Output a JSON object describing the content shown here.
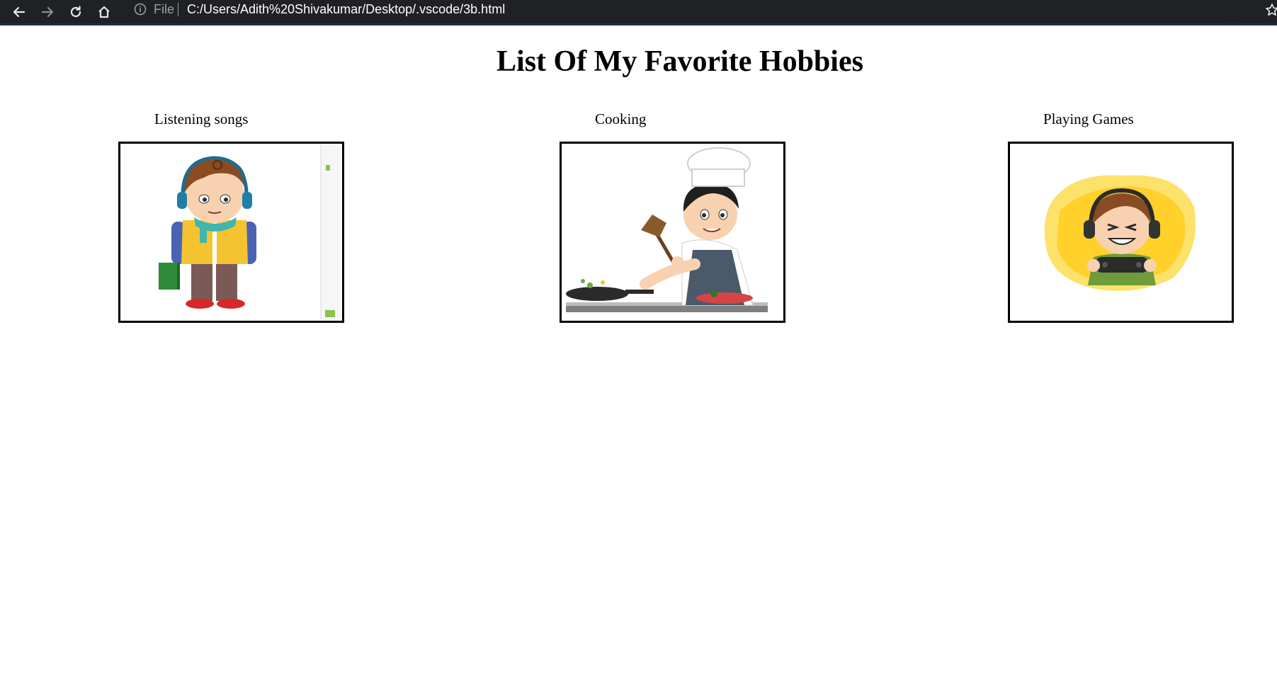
{
  "browser": {
    "url_scheme": "File",
    "url": "C:/Users/Adith%20Shivakumar/Desktop/.vscode/3b.html",
    "icons": {
      "back": "back-arrow-icon",
      "forward": "forward-arrow-icon",
      "reload": "reload-icon",
      "home": "home-icon",
      "info": "info-icon",
      "bookmark": "star-icon"
    },
    "colors": {
      "toolbar": "#202124",
      "url_text": "#ffffff",
      "muted": "#9aa0a6"
    }
  },
  "page": {
    "title": "List Of My Favorite Hobbies",
    "hobbies": [
      {
        "label": "Listening songs",
        "image": "boy-with-headphones-image"
      },
      {
        "label": "Cooking",
        "image": "boy-chef-cooking-image"
      },
      {
        "label": "Playing Games",
        "image": "boy-gamer-with-controller-image"
      }
    ]
  }
}
